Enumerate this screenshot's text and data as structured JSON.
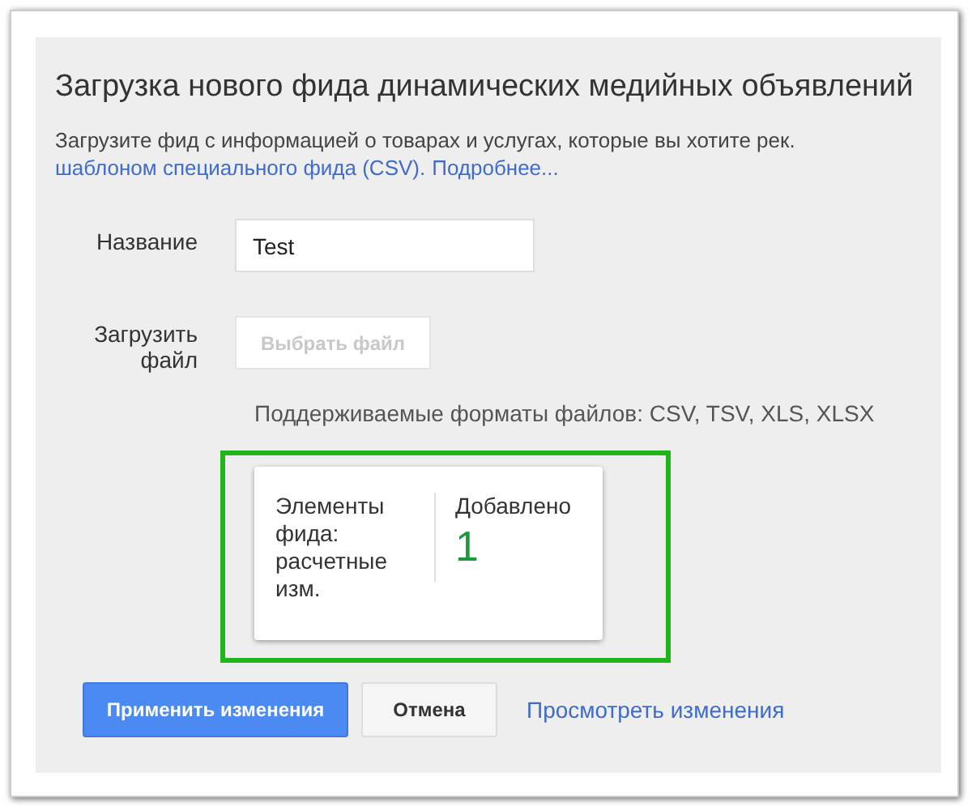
{
  "dialog": {
    "title": "Загрузка нового фида динамических медийных объявлений",
    "description": "Загрузите фид с информацией о товарах и услугах, которые вы хотите рек.",
    "links": [
      "шаблоном специального фида (CSV).",
      "Подробнее..."
    ],
    "name_field": {
      "label": "Название",
      "value": "Test"
    },
    "upload": {
      "label": "Загрузить файл",
      "button": "Выбрать файл",
      "disabled": true,
      "hint": "Поддерживаемые форматы файлов: CSV, TSV, XLS, XLSX"
    },
    "summary": {
      "label": "Элементы фида: расчетные изм.",
      "column": "Добавлено",
      "count": "1"
    },
    "buttons": [
      {
        "kind": "primary",
        "label": "Применить изменения"
      },
      {
        "kind": "secondary",
        "label": "Отмена"
      },
      {
        "kind": "link",
        "label": "Просмотреть изменения"
      }
    ]
  }
}
